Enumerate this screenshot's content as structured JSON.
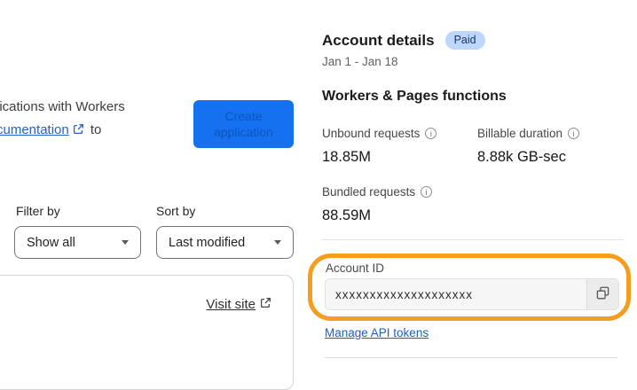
{
  "left_panel": {
    "intro_line1": "lications with Workers",
    "intro_link_text": "cumentation",
    "intro_suffix": "to",
    "create_button": {
      "line1": "Create",
      "line2": "application"
    },
    "filter": {
      "label": "Filter by",
      "value": "Show all"
    },
    "sort": {
      "label": "Sort by",
      "value": "Last modified"
    },
    "project_card": {
      "visit_site_label": "Visit site"
    }
  },
  "account_panel": {
    "title": "Account details",
    "plan_badge": "Paid",
    "date_range": "Jan 1 - Jan 18",
    "functions_title": "Workers & Pages functions",
    "stats": [
      {
        "label": "Unbound requests",
        "value": "18.85M"
      },
      {
        "label": "Billable duration",
        "value": "8.88k GB-sec"
      },
      {
        "label": "Bundled requests",
        "value": "88.59M"
      }
    ],
    "account_id": {
      "label": "Account ID",
      "value": "xxxxxxxxxxxxxxxxxxxx"
    },
    "manage_link_label": "Manage API tokens"
  },
  "icons": {
    "info": "info-icon",
    "external_link": "external-link-icon",
    "copy": "copy-icon",
    "chevron_down": "chevron-down-icon"
  },
  "colors": {
    "button_blue": "#1671f0",
    "button_text_blue": "#0d55bd",
    "link_blue": "#2262c9",
    "badge_bg": "#bdd6f9",
    "badge_text": "#15376e",
    "annotation_orange": "#f59d1e",
    "input_bg": "#f6f6f6"
  }
}
